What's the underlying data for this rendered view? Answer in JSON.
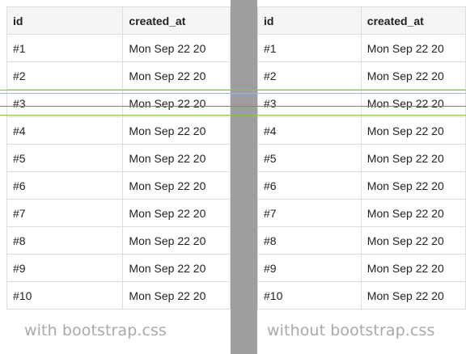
{
  "table": {
    "headers": [
      "id",
      "created_at"
    ],
    "rows": [
      {
        "id": "#1",
        "created_at": "Mon Sep 22 20"
      },
      {
        "id": "#2",
        "created_at": "Mon Sep 22 20"
      },
      {
        "id": "#3",
        "created_at": "Mon Sep 22 20"
      },
      {
        "id": "#4",
        "created_at": "Mon Sep 22 20"
      },
      {
        "id": "#5",
        "created_at": "Mon Sep 22 20"
      },
      {
        "id": "#6",
        "created_at": "Mon Sep 22 20"
      },
      {
        "id": "#7",
        "created_at": "Mon Sep 22 20"
      },
      {
        "id": "#8",
        "created_at": "Mon Sep 22 20"
      },
      {
        "id": "#9",
        "created_at": "Mon Sep 22 20"
      },
      {
        "id": "#10",
        "created_at": "Mon Sep 22 20"
      }
    ]
  },
  "captions": {
    "left": "with bootstrap.css",
    "right": "without bootstrap.css"
  },
  "colors": {
    "divider": "#9e9e9e",
    "guide_green": "#7cc84a",
    "guide_red": "#e05a5a",
    "caption": "#a9a9a9"
  }
}
